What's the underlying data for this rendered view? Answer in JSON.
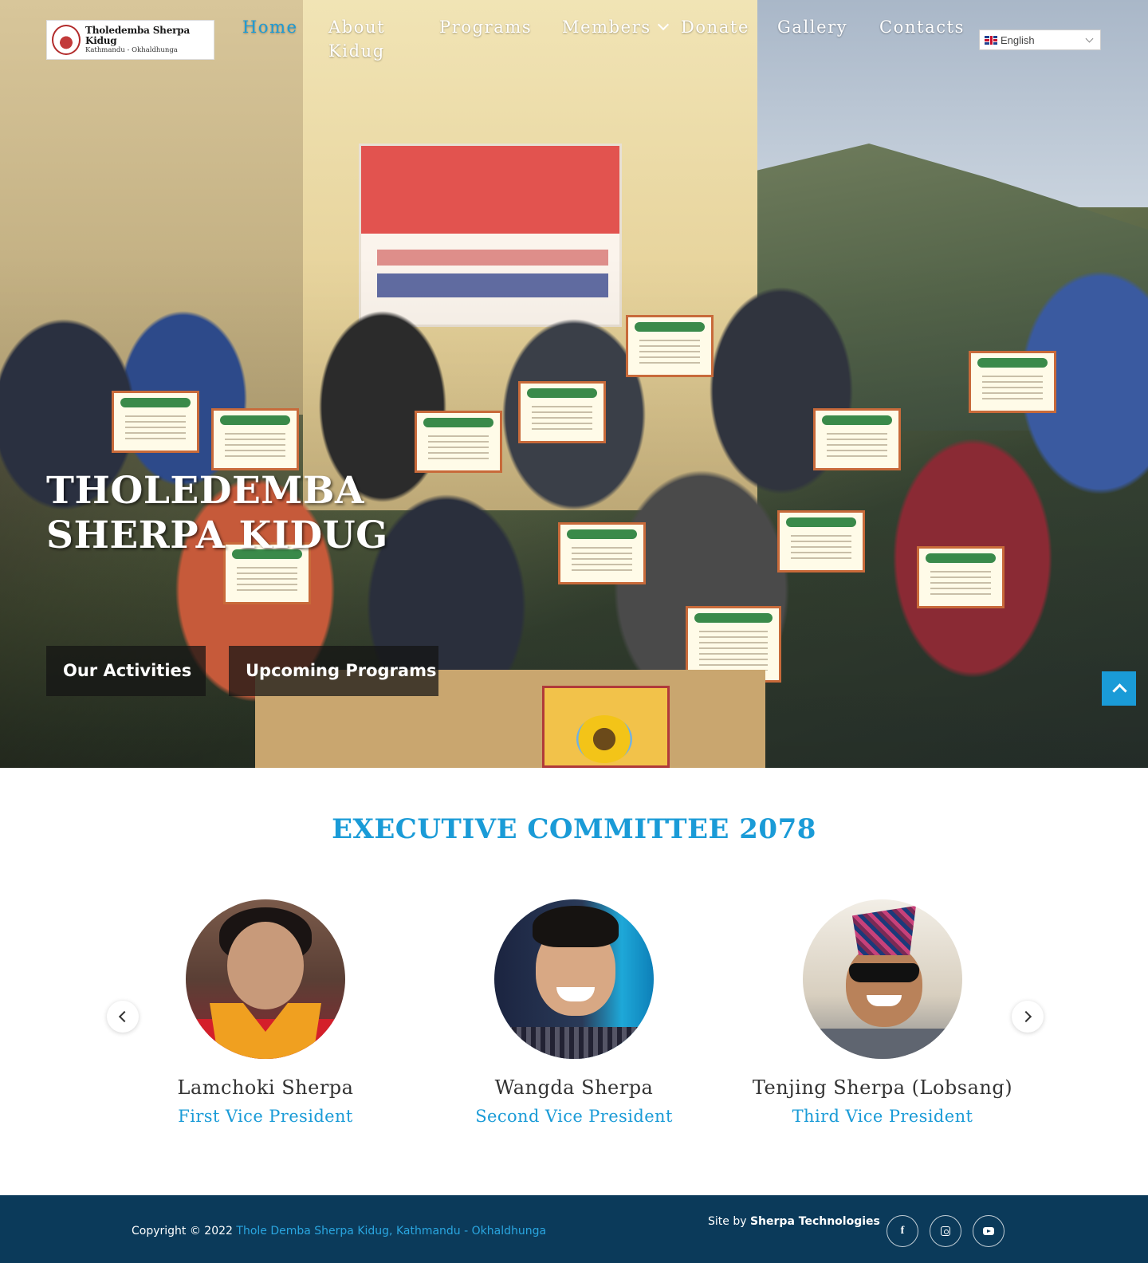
{
  "brand": {
    "name": "Tholedemba Sherpa Kidug",
    "subtitle": "Kathmandu - Okhaldhunga"
  },
  "nav": {
    "items": [
      {
        "label": "Home",
        "active": true
      },
      {
        "label": "About Kidug"
      },
      {
        "label": "Programs"
      },
      {
        "label": "Members",
        "has_dropdown": true
      },
      {
        "label": "Donate"
      },
      {
        "label": "Gallery"
      },
      {
        "label": "Contacts"
      }
    ]
  },
  "language": {
    "selected": "English",
    "icon": "uk-flag-icon"
  },
  "hero": {
    "title": "THOLEDEMBA SHERPA KIDUG",
    "buttons": [
      "Our Activities",
      "Upcoming Programs"
    ]
  },
  "committee": {
    "title": "EXECUTIVE COMMITTEE 2078",
    "members": [
      {
        "name": "Lamchoki Sherpa",
        "role": "First Vice President"
      },
      {
        "name": "Wangda Sherpa",
        "role": "Second Vice President"
      },
      {
        "name": "Tenjing Sherpa (Lobsang)",
        "role": "Third Vice President"
      }
    ]
  },
  "footer": {
    "copyright_prefix": "Copyright © 2022",
    "org_link": "Thole Demba Sherpa Kidug, Kathmandu - Okhaldhunga",
    "site_by_prefix": "Site by",
    "site_by_name": "Sherpa Technologies",
    "social": [
      "facebook-icon",
      "instagram-icon",
      "youtube-icon"
    ]
  },
  "colors": {
    "accent": "#1a9bd7",
    "footer_bg": "#0b3a5a"
  }
}
